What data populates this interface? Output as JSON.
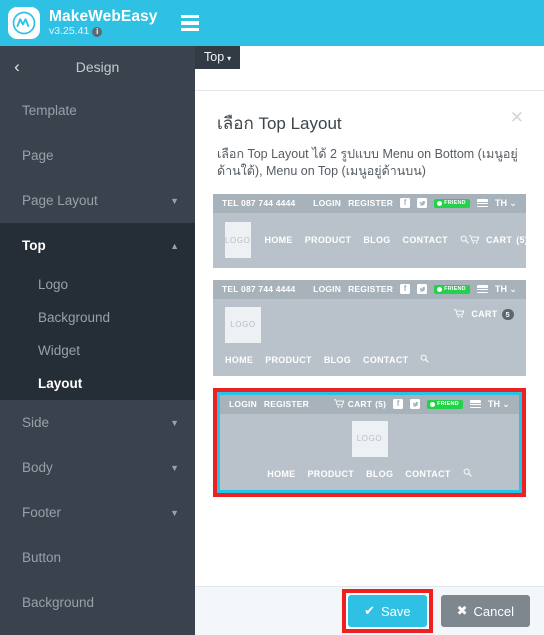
{
  "appbar": {
    "logo_icon": "makewebeasy-logo-icon",
    "brand_name": "MakeWebEasy",
    "version": "v3.25.41",
    "info_icon": "i",
    "menu_icon": "hamburger-menu-icon"
  },
  "sidebar": {
    "back_icon": "‹",
    "title": "Design",
    "items": [
      {
        "label": "Template",
        "caret": ""
      },
      {
        "label": "Page",
        "caret": ""
      },
      {
        "label": "Page Layout",
        "caret": "▼"
      }
    ],
    "section": {
      "label": "Top",
      "caret": "▲",
      "sub_items": [
        {
          "label": "Logo"
        },
        {
          "label": "Background"
        },
        {
          "label": "Widget"
        },
        {
          "label": "Layout"
        }
      ]
    },
    "items_after": [
      {
        "label": "Side",
        "caret": "▼"
      },
      {
        "label": "Body",
        "caret": "▼"
      },
      {
        "label": "Footer",
        "caret": "▼"
      },
      {
        "label": "Button",
        "caret": ""
      },
      {
        "label": "Background",
        "caret": ""
      }
    ]
  },
  "content": {
    "top_tab": {
      "label": "Top",
      "caret": "▾"
    }
  },
  "modal": {
    "title": "เลือก Top Layout",
    "close_icon": "✕",
    "description": "เลือก Top Layout ได้ 2 รูปแบบ Menu on Bottom (เมนูอยู่ด้านใต้), Menu on Top (เมนูอยู่ด้านบน)",
    "save_label": "Save",
    "save_icon": "✔",
    "cancel_label": "Cancel",
    "cancel_icon": "✖",
    "accent_color": "#2fc1e4",
    "highlight_color": "#ee2020",
    "selected_color": "#23c4e8"
  },
  "previews": {
    "common": {
      "tel": "TEL 087 744 4444",
      "login": "LOGIN",
      "register": "REGISTER",
      "facebook_icon": "f",
      "twitter_icon": "ᵛ",
      "line_badge": "FRIEND",
      "flag_icon": "flag-icon",
      "lang": "TH",
      "lang_caret": "⌄",
      "logo_text": "LOGO",
      "menu": [
        "HOME",
        "PRODUCT",
        "BLOG",
        "CONTACT"
      ],
      "search_icon": "⌕",
      "cart_icon": "Ὥ2",
      "cart_label": "CART",
      "cart_count_paren": "(5)",
      "cart_count": "5"
    },
    "options": [
      {
        "name": "menu-inline-with-logo",
        "selected": false
      },
      {
        "name": "menu-on-bottom",
        "selected": false
      },
      {
        "name": "menu-on-top-centered",
        "selected": true
      }
    ]
  }
}
